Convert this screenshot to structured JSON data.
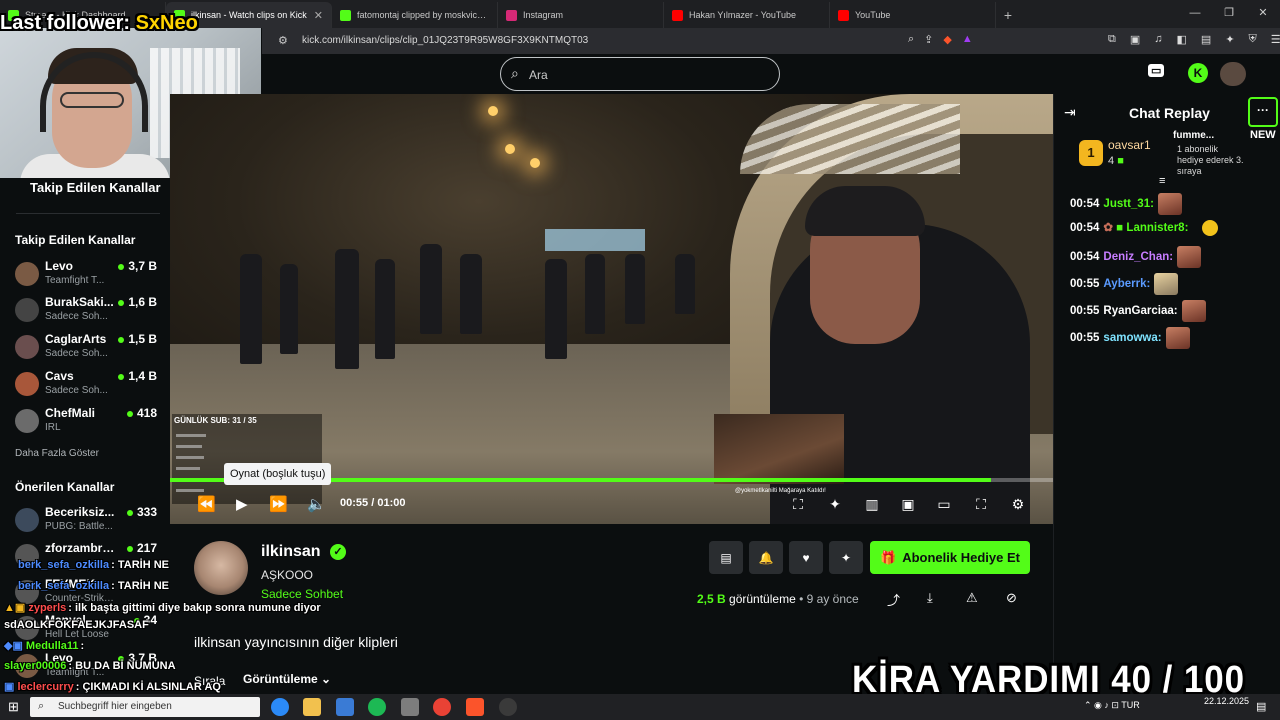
{
  "tabs": [
    {
      "label": "Stream - Kick Dashboard",
      "color": "#53fc18"
    },
    {
      "label": "ilkinsan - Watch clips on Kick",
      "color": "#53fc18",
      "active": true
    },
    {
      "label": "fatomontaj clipped by moskvich35",
      "color": "#53fc18"
    },
    {
      "label": "Instagram",
      "color": "#d62976"
    },
    {
      "label": "Hakan Yılmazer - YouTube",
      "color": "#ff0000"
    },
    {
      "label": "YouTube",
      "color": "#ff0000"
    }
  ],
  "address": {
    "url": "kick.com/ilkinsan/clips/clip_01JQ23T9R95W8GF3X9KNTMQT03"
  },
  "search": {
    "placeholder": "Ara"
  },
  "overlay": {
    "last_follower_label": "Last follower: ",
    "last_follower_name": "SxNeo",
    "banner": "KİRA YARDIMI  40 / 100"
  },
  "sidebar": {
    "heading_top": "Takip Edilen Kanallar",
    "followed_heading": "Takip Edilen Kanallar",
    "followed": [
      {
        "name": "Levo",
        "sub": "Teamfight T...",
        "viewers": "3,7 B",
        "color": "#7a5a44"
      },
      {
        "name": "BurakSaki...",
        "sub": "Sadece Soh...",
        "viewers": "1,6 B",
        "color": "#444"
      },
      {
        "name": "CaglarArts",
        "sub": "Sadece Soh...",
        "viewers": "1,5 B",
        "color": "#6a4e4e"
      },
      {
        "name": "Cavs",
        "sub": "Sadece Soh...",
        "viewers": "1,4 B",
        "color": "#a8573a"
      },
      {
        "name": "ChefMali",
        "sub": "IRL",
        "viewers": "418",
        "color": "#6b6b6b"
      }
    ],
    "show_more": "Daha Fazla Göster",
    "recommended_heading": "Önerilen Kanallar",
    "recommended": [
      {
        "name": "Beceriksiz...",
        "sub": "PUBG: Battle...",
        "viewers": "333",
        "color": "#3c4a5c"
      },
      {
        "name": "zforzambro...",
        "sub": "",
        "viewers": "217",
        "color": "#555"
      },
      {
        "name": "FEYMEK",
        "sub": "Counter-Strike 2",
        "viewers": "",
        "color": "#555"
      },
      {
        "name": "Manyel",
        "sub": "Hell Let Loose",
        "viewers": "34",
        "color": "#555"
      },
      {
        "name": "Levo",
        "sub": "Teamfight T...",
        "viewers": "3,7 B",
        "color": "#7a5a44"
      }
    ]
  },
  "player": {
    "overlay_counter": "GÜNLÜK SUB: 31 / 35",
    "inset_caption": "@yokmetlkanilti Mağaraya Katıldı!",
    "tooltip": "Oynat (boşluk tuşu)",
    "current_time": "00:55",
    "separator": "/",
    "duration": "01:00",
    "progress": 0.93
  },
  "clip": {
    "owner": "ilkinsan",
    "title": "AŞKOOO",
    "category": "Sadece Sohbet",
    "gift_button": "Abonelik Hediye Et",
    "views": "2,5 B",
    "views_label": "görüntüleme",
    "age": "9 ay önce",
    "more_clips": "ilkinsan yayıncısının diğer klipleri",
    "sort_label": "Sırala",
    "sort_value": "Görüntüleme"
  },
  "chat": {
    "title": "Chat Replay",
    "new_label": "NEW",
    "pinned": {
      "rank": "1",
      "name": "oavsar1",
      "count": "4",
      "side_name": "fumme...",
      "side_text": "1 abonelik hediye ederek 3. sıraya"
    },
    "messages": [
      {
        "time": "00:54",
        "user": "Justt_31:",
        "color": "#53fc18"
      },
      {
        "time": "00:54",
        "user": "Lannister8:",
        "color": "#53fc18"
      },
      {
        "time": "00:54",
        "user": "Deniz_Chan:",
        "color": "#c77dff"
      },
      {
        "time": "00:55",
        "user": "Ayberrk:",
        "color": "#5b9bff"
      },
      {
        "time": "00:55",
        "user": "RyanGarciaa:",
        "color": "#ffffff"
      },
      {
        "time": "00:55",
        "user": "samowwa:",
        "color": "#7fe3ff"
      }
    ]
  },
  "overlay_chat": [
    {
      "user": "berk_sefa_ozkilla",
      "text": ": TARİH NE",
      "color": "#4d8bff"
    },
    {
      "user": "berk_sefa_ozkilla",
      "text": ": TARİH NE",
      "color": "#4d8bff"
    },
    {
      "user": "zyperls",
      "text": ": ilk başta gittimi diye bakıp sonra numune diyor",
      "color": "#ff4d4d"
    },
    {
      "user": "",
      "text": "sdAOLKFOKFAEJKJFASAF",
      "color": "#ffffff"
    },
    {
      "user": "Medulla11",
      "text": ":",
      "color": "#53fc18"
    },
    {
      "user": "slayer00006",
      "text": ": BU DA Bİ NUMUNA",
      "color": "#53fc18"
    },
    {
      "user": "leclercurry",
      "text": ": ÇIKMADI Kİ ALSINLAR AQ",
      "color": "#ff4d4d"
    }
  ],
  "taskbar": {
    "search_placeholder": "Suchbegriff hier eingeben",
    "lang": "TUR",
    "time": "",
    "date": "22.12.2025"
  }
}
